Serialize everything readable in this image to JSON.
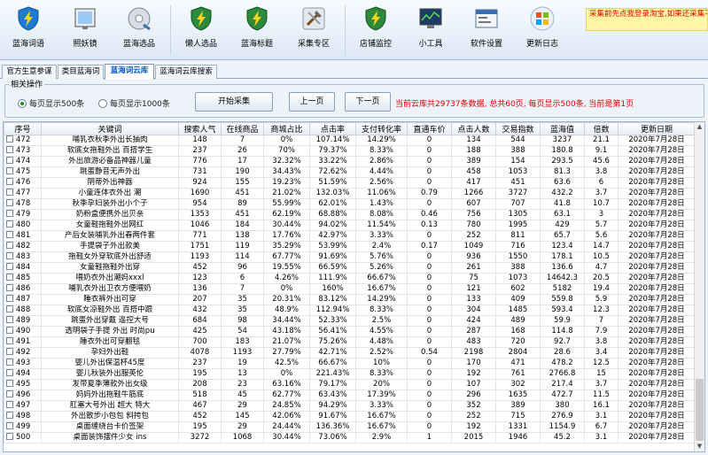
{
  "toolbar": {
    "items": [
      {
        "label": "蓝海词语",
        "icon": "lightning-shield-icon"
      },
      {
        "label": "照妖镜",
        "icon": "mirror-icon"
      },
      {
        "label": "蓝海选品",
        "icon": "disc-icon"
      },
      {
        "label": "懒人选品",
        "icon": "lightning-shield-icon"
      },
      {
        "label": "蓝海标题",
        "icon": "lightning-shield-icon"
      },
      {
        "label": "采集专区",
        "icon": "tools-icon"
      },
      {
        "label": "店铺监控",
        "icon": "lightning-shield-icon"
      },
      {
        "label": "小工具",
        "icon": "monitor-chart-icon"
      },
      {
        "label": "软件设置",
        "icon": "settings-window-icon"
      },
      {
        "label": "更新日志",
        "icon": "windows-logo-icon"
      }
    ],
    "notice": "采集前先点我登录淘宝,如果还采集不到数据请换其他淘宝账号登录"
  },
  "tabs": [
    "官方生意参谋",
    "类目蓝海词",
    "蓝海词云库",
    "蓝海词云库搜索"
  ],
  "controls": {
    "group_title": "相关操作",
    "radio_500": "每页显示500条",
    "radio_1000": "每页显示1000条",
    "start_button": "开始采集",
    "prev_button": "上一页",
    "next_button": "下一页",
    "status": "当前云库共29737条数据, 总共60页, 每页显示500条, 当前是第1页"
  },
  "table": {
    "headers": [
      "序号",
      "关键词",
      "搜索人气",
      "在线商品",
      "商城占比",
      "点击率",
      "支付转化率",
      "直通车价",
      "点击人数",
      "交易指数",
      "蓝海值",
      "倍数",
      "更新日期"
    ],
    "rows": [
      [
        "472",
        "哺乳衣秋季外出长抽肉",
        "148",
        "7",
        "0%",
        "107.14%",
        "14.29%",
        "0",
        "134",
        "544",
        "3237",
        "21.1",
        "2020年7月28日"
      ],
      [
        "473",
        "软底女拖鞋外出 百搭学生",
        "237",
        "26",
        "70%",
        "79.37%",
        "8.33%",
        "0",
        "188",
        "388",
        "180.8",
        "9.1",
        "2020年7月28日"
      ],
      [
        "474",
        "外出旅游必备品神器儿童",
        "776",
        "17",
        "32.32%",
        "33.22%",
        "2.86%",
        "0",
        "389",
        "154",
        "293.5",
        "45.6",
        "2020年7月28日"
      ],
      [
        "475",
        "跳蛋静音无声外出",
        "731",
        "190",
        "34.43%",
        "72.62%",
        "4.44%",
        "0",
        "458",
        "1053",
        "81.3",
        "3.8",
        "2020年7月28日"
      ],
      [
        "476",
        "阴蒂外出神器",
        "924",
        "155",
        "19.23%",
        "51.59%",
        "2.56%",
        "0",
        "417",
        "451",
        "63.6",
        "6",
        "2020年7月28日"
      ],
      [
        "477",
        "小童连体衣外出 潮",
        "1690",
        "451",
        "21.02%",
        "132.03%",
        "11.06%",
        "0.79",
        "1266",
        "3727",
        "432.2",
        "3.7",
        "2020年7月28日"
      ],
      [
        "478",
        "秋季孕妇装外出小个子",
        "954",
        "89",
        "55.99%",
        "62.01%",
        "1.43%",
        "0",
        "607",
        "707",
        "41.8",
        "10.7",
        "2020年7月28日"
      ],
      [
        "479",
        "奶粉盒便携外出贝亲",
        "1353",
        "451",
        "62.19%",
        "68.88%",
        "8.08%",
        "0.46",
        "756",
        "1305",
        "63.1",
        "3",
        "2020年7月28日"
      ],
      [
        "480",
        "女童鞋拖鞋外出网红",
        "1046",
        "184",
        "30.44%",
        "94.02%",
        "11.54%",
        "0.13",
        "780",
        "1995",
        "429",
        "5.7",
        "2020年7月28日"
      ],
      [
        "481",
        "产后女装哺乳外出春两件套",
        "771",
        "138",
        "17.76%",
        "42.97%",
        "3.33%",
        "0",
        "252",
        "811",
        "65.7",
        "5.6",
        "2020年7月28日"
      ],
      [
        "482",
        "手提袋子外出款美",
        "1751",
        "119",
        "35.29%",
        "53.99%",
        "2.4%",
        "0.17",
        "1049",
        "716",
        "123.4",
        "14.7",
        "2020年7月28日"
      ],
      [
        "483",
        "拖鞋女外穿软底外出舒适",
        "1193",
        "114",
        "67.77%",
        "91.69%",
        "5.76%",
        "0",
        "936",
        "1550",
        "178.1",
        "10.5",
        "2020年7月28日"
      ],
      [
        "484",
        "女童鞋拖鞋外出穿",
        "452",
        "96",
        "19.55%",
        "66.59%",
        "5.26%",
        "0",
        "261",
        "388",
        "136.6",
        "4.7",
        "2020年7月28日"
      ],
      [
        "485",
        "喂奶衣外出潮妈xxxl",
        "123",
        "6",
        "4.26%",
        "111.9%",
        "66.67%",
        "0",
        "75",
        "1073",
        "14642.3",
        "20.5",
        "2020年7月28日"
      ],
      [
        "486",
        "哺乳衣外出卫衣方便喂奶",
        "136",
        "7",
        "0%",
        "160%",
        "16.67%",
        "0",
        "121",
        "602",
        "5182",
        "19.4",
        "2020年7月28日"
      ],
      [
        "487",
        "睡衣裤外出可穿",
        "207",
        "35",
        "20.31%",
        "83.12%",
        "14.29%",
        "0",
        "133",
        "409",
        "559.8",
        "5.9",
        "2020年7月28日"
      ],
      [
        "488",
        "软底女凉鞋外出 百搭中跟",
        "432",
        "35",
        "48.9%",
        "112.94%",
        "8.33%",
        "0",
        "304",
        "1485",
        "593.4",
        "12.3",
        "2020年7月28日"
      ],
      [
        "489",
        "跳蛋外出穿戴 遥控大号",
        "684",
        "98",
        "34.44%",
        "52.33%",
        "2.5%",
        "0",
        "424",
        "489",
        "59.9",
        "7",
        "2020年7月28日"
      ],
      [
        "490",
        "透明袋子手提 外出 时尚pu",
        "425",
        "54",
        "43.18%",
        "56.41%",
        "4.55%",
        "0",
        "287",
        "168",
        "114.8",
        "7.9",
        "2020年7月28日"
      ],
      [
        "491",
        "睡衣外出可穿翻毯",
        "700",
        "183",
        "21.07%",
        "75.26%",
        "4.48%",
        "0",
        "483",
        "720",
        "92.7",
        "3.8",
        "2020年7月28日"
      ],
      [
        "492",
        "孕妇外出鞋",
        "4078",
        "1193",
        "27.79%",
        "42.71%",
        "2.52%",
        "0.54",
        "2198",
        "2804",
        "28.6",
        "3.4",
        "2020年7月28日"
      ],
      [
        "493",
        "婴儿外出保温杯45度",
        "237",
        "19",
        "42.5%",
        "66.67%",
        "10%",
        "0",
        "170",
        "471",
        "478.2",
        "12.5",
        "2020年7月28日"
      ],
      [
        "494",
        "婴儿秋装外出服英伦",
        "195",
        "13",
        "0%",
        "221.43%",
        "8.33%",
        "0",
        "192",
        "761",
        "2766.8",
        "15",
        "2020年7月28日"
      ],
      [
        "495",
        "发带夏季薄款外出女级",
        "208",
        "23",
        "63.16%",
        "79.17%",
        "20%",
        "0",
        "107",
        "302",
        "217.4",
        "3.7",
        "2020年7月28日"
      ],
      [
        "496",
        "妈妈外出拖鞋牛筋底",
        "518",
        "45",
        "62.77%",
        "63.43%",
        "17.39%",
        "0",
        "296",
        "1635",
        "472.7",
        "11.5",
        "2020年7月28日"
      ],
      [
        "497",
        "肛塞大号外出 超大 特大",
        "467",
        "29",
        "24.85%",
        "94.29%",
        "3.33%",
        "0",
        "352",
        "389",
        "380",
        "16.1",
        "2020年7月28日"
      ],
      [
        "498",
        "外出散步小包包 斜挎包",
        "452",
        "145",
        "42.06%",
        "91.67%",
        "16.67%",
        "0",
        "252",
        "715",
        "276.9",
        "3.1",
        "2020年7月28日"
      ],
      [
        "499",
        "桌面缠绕台卡价签架",
        "195",
        "29",
        "24.44%",
        "136.36%",
        "16.67%",
        "0",
        "192",
        "1331",
        "1154.9",
        "6.7",
        "2020年7月28日"
      ],
      [
        "500",
        "桌面装饰摆件少女 ins",
        "3272",
        "1068",
        "30.44%",
        "73.06%",
        "2.9%",
        "1",
        "2015",
        "1946",
        "45.2",
        "3.1",
        "2020年7月28日"
      ]
    ]
  }
}
